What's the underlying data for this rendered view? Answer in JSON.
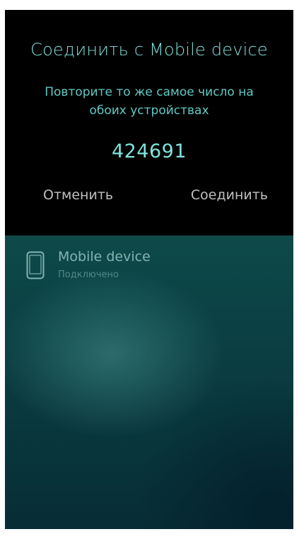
{
  "pairing_dialog": {
    "title": "Соединить с Mobile device",
    "instruction": "Повторите то же самое число на обоих устройствах",
    "passkey": "424691",
    "cancel_label": "Отменить",
    "connect_label": "Соединить"
  },
  "device_list": {
    "items": [
      {
        "icon": "phone-icon",
        "name": "Mobile device",
        "status": "Подключено"
      }
    ]
  },
  "colors": {
    "dialog_background": "#000000",
    "accent_highlight": "#7fe3dd",
    "accent_secondary": "#5ec9c4",
    "button_text": "#bfbfbf",
    "ambience_top": "#11564f",
    "ambience_bottom": "#072d36"
  }
}
